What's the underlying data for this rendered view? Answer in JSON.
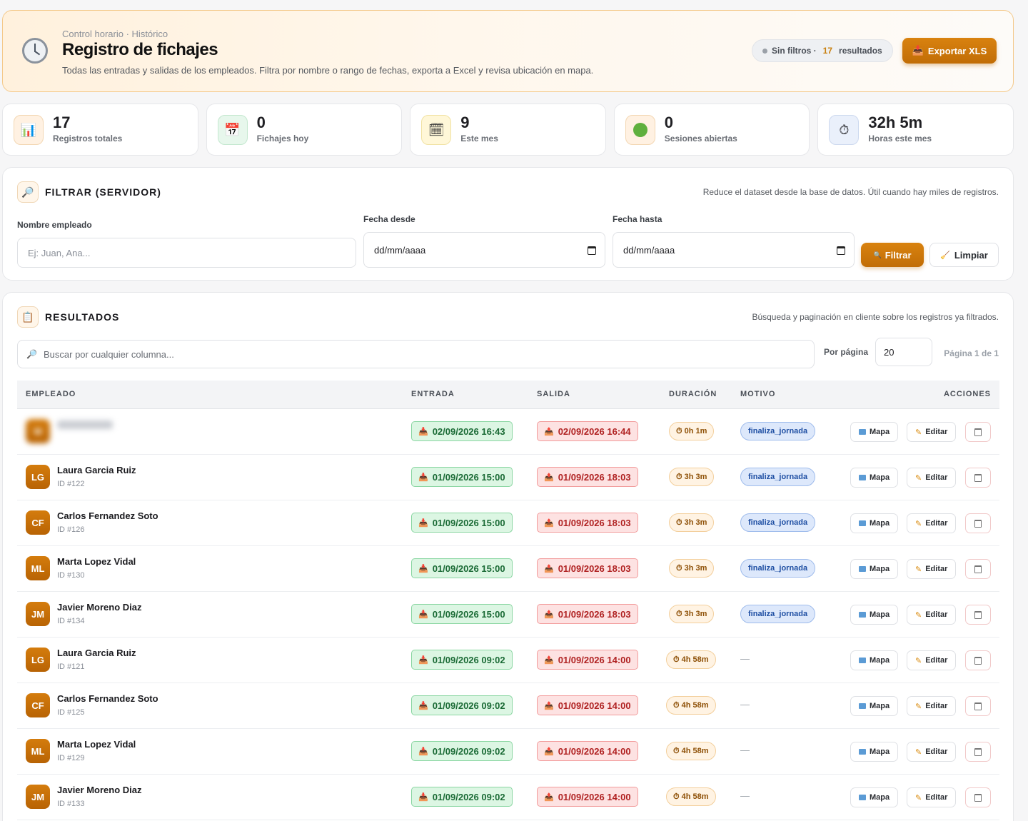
{
  "header": {
    "breadcrumb": "Control horario · Histórico",
    "title": "Registro de fichajes",
    "subtitle": "Todas las entradas y salidas de los empleados. Filtra por nombre o rango de fechas, exporta a Excel y revisa ubicación en mapa.",
    "filters_label": "Sin filtros ·",
    "results_count": "17",
    "results_label": "resultados",
    "export_label": "Exportar XLS"
  },
  "stats": [
    {
      "value": "17",
      "label": "Registros totales",
      "icon": "chart-icon"
    },
    {
      "value": "0",
      "label": "Fichajes hoy",
      "icon": "calendar-icon"
    },
    {
      "value": "9",
      "label": "Este mes",
      "icon": "month-calendar-icon"
    },
    {
      "value": "0",
      "label": "Sesiones abiertas",
      "icon": "green-dot-icon"
    },
    {
      "value": "32h 5m",
      "label": "Horas este mes",
      "icon": "stopwatch-icon"
    }
  ],
  "filter": {
    "title": "FILTRAR (SERVIDOR)",
    "note": "Reduce el dataset desde la base de datos. Útil cuando hay miles de registros.",
    "name_label": "Nombre empleado",
    "name_placeholder": "Ej: Juan, Ana...",
    "from_label": "Fecha desde",
    "from_value": "dd/mm/aaaa",
    "to_label": "Fecha hasta",
    "to_value": "dd/mm/aaaa",
    "filter_button": "Filtrar",
    "clear_button": "Limpiar"
  },
  "results": {
    "title": "RESULTADOS",
    "note": "Búsqueda y paginación en cliente sobre los registros ya filtrados.",
    "search_placeholder": "Buscar por cualquier columna...",
    "per_page_label": "Por página",
    "per_page_value": "20",
    "page_info": "Página 1 de 1",
    "columns": [
      "EMPLEADO",
      "ENTRADA",
      "SALIDA",
      "DURACIÓN",
      "MOTIVO",
      "ACCIONES"
    ],
    "action_labels": {
      "map": "Mapa",
      "edit": "Editar"
    },
    "rows": [
      {
        "initials": "M",
        "name": "",
        "id": "",
        "entrada": "02/09/2026 16:43",
        "salida": "02/09/2026 16:44",
        "duracion": "0h 1m",
        "motivo": "finaliza_jornada"
      },
      {
        "initials": "LG",
        "name": "Laura Garcia Ruiz",
        "id": "ID #122",
        "entrada": "01/09/2026 15:00",
        "salida": "01/09/2026 18:03",
        "duracion": "3h 3m",
        "motivo": "finaliza_jornada"
      },
      {
        "initials": "CF",
        "name": "Carlos Fernandez Soto",
        "id": "ID #126",
        "entrada": "01/09/2026 15:00",
        "salida": "01/09/2026 18:03",
        "duracion": "3h 3m",
        "motivo": "finaliza_jornada"
      },
      {
        "initials": "ML",
        "name": "Marta Lopez Vidal",
        "id": "ID #130",
        "entrada": "01/09/2026 15:00",
        "salida": "01/09/2026 18:03",
        "duracion": "3h 3m",
        "motivo": "finaliza_jornada"
      },
      {
        "initials": "JM",
        "name": "Javier Moreno Diaz",
        "id": "ID #134",
        "entrada": "01/09/2026 15:00",
        "salida": "01/09/2026 18:03",
        "duracion": "3h 3m",
        "motivo": "finaliza_jornada"
      },
      {
        "initials": "LG",
        "name": "Laura Garcia Ruiz",
        "id": "ID #121",
        "entrada": "01/09/2026 09:02",
        "salida": "01/09/2026 14:00",
        "duracion": "4h 58m",
        "motivo": "—"
      },
      {
        "initials": "CF",
        "name": "Carlos Fernandez Soto",
        "id": "ID #125",
        "entrada": "01/09/2026 09:02",
        "salida": "01/09/2026 14:00",
        "duracion": "4h 58m",
        "motivo": "—"
      },
      {
        "initials": "ML",
        "name": "Marta Lopez Vidal",
        "id": "ID #129",
        "entrada": "01/09/2026 09:02",
        "salida": "01/09/2026 14:00",
        "duracion": "4h 58m",
        "motivo": "—"
      },
      {
        "initials": "JM",
        "name": "Javier Moreno Diaz",
        "id": "ID #133",
        "entrada": "01/09/2026 09:02",
        "salida": "01/09/2026 14:00",
        "duracion": "4h 58m",
        "motivo": "—"
      }
    ]
  },
  "colors": {
    "accent": "#c97406",
    "entrada": "#1b6b36",
    "salida": "#b02222",
    "motivo": "#1f4fa3"
  }
}
